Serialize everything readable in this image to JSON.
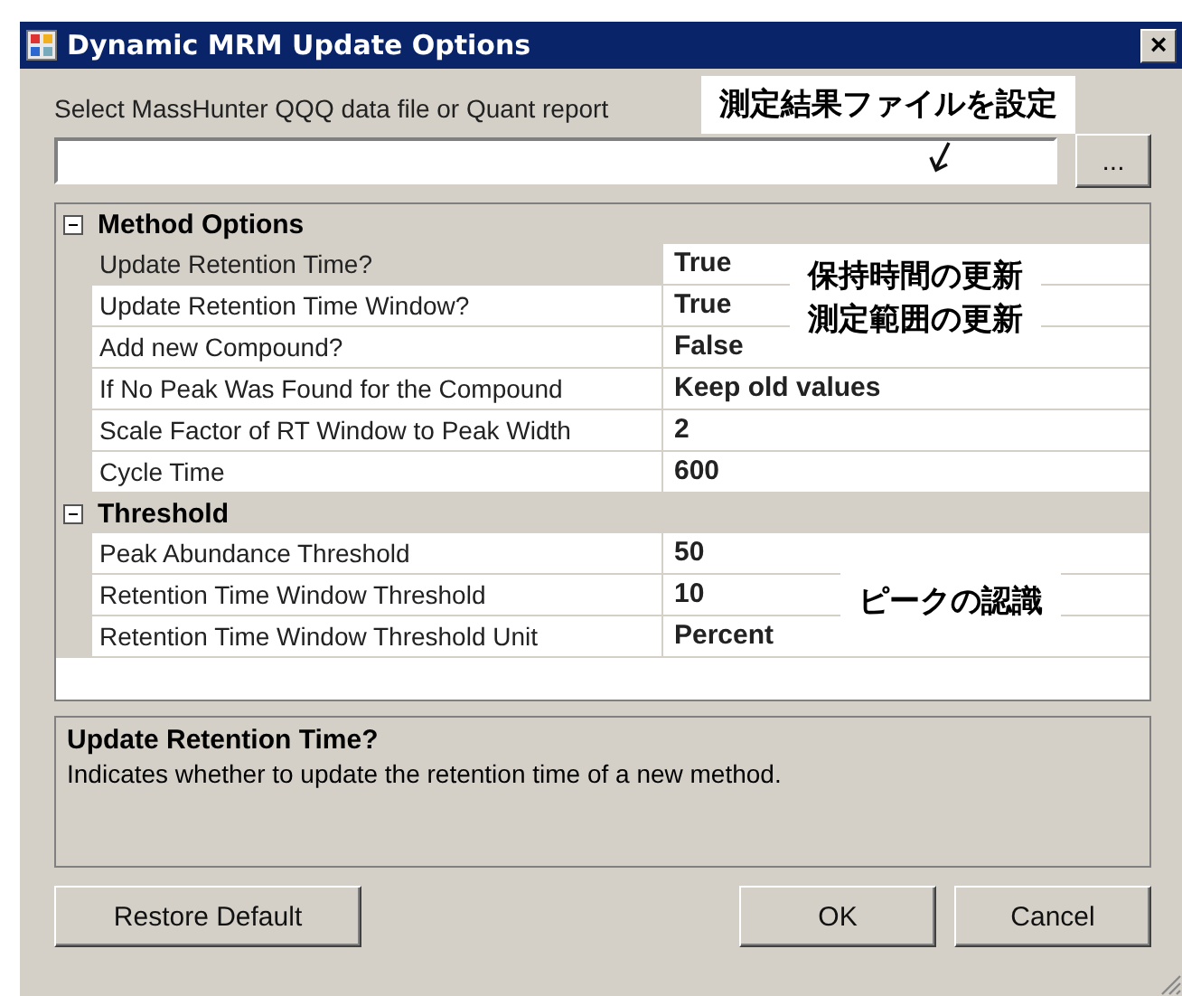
{
  "window": {
    "title": "Dynamic MRM Update Options",
    "close": "×"
  },
  "file_label": "Select MassHunter QQQ data file or Quant report",
  "browse_button": "...",
  "categories": [
    {
      "name": "Method Options",
      "expanded": true,
      "rows": [
        {
          "name": "Update Retention Time?",
          "value": "True",
          "selected": true
        },
        {
          "name": "Update Retention Time Window?",
          "value": "True",
          "selected": false
        },
        {
          "name": "Add new Compound?",
          "value": "False",
          "selected": false
        },
        {
          "name": "If No Peak Was Found for the Compound",
          "value": "Keep old values",
          "selected": false
        },
        {
          "name": "Scale Factor of RT Window to Peak Width",
          "value": "2",
          "selected": false
        },
        {
          "name": "Cycle Time",
          "value": "600",
          "selected": false
        }
      ]
    },
    {
      "name": "Threshold",
      "expanded": true,
      "rows": [
        {
          "name": "Peak Abundance Threshold",
          "value": "50",
          "selected": false
        },
        {
          "name": "Retention Time Window Threshold",
          "value": "10",
          "selected": false
        },
        {
          "name": "Retention Time Window Threshold Unit",
          "value": "Percent",
          "selected": false
        }
      ]
    }
  ],
  "description": {
    "title": "Update Retention Time?",
    "text": "Indicates whether to update the retention time of a new method."
  },
  "buttons": {
    "restore": "Restore Default",
    "ok": "OK",
    "cancel": "Cancel"
  },
  "annotations": [
    {
      "kind": "file",
      "lines": [
        "測定結果ファイルを設定"
      ]
    },
    {
      "kind": "retention",
      "lines": [
        "保持時間の更新",
        "測定範囲の更新"
      ]
    },
    {
      "kind": "peak",
      "lines": [
        "ピークの認識"
      ]
    }
  ]
}
